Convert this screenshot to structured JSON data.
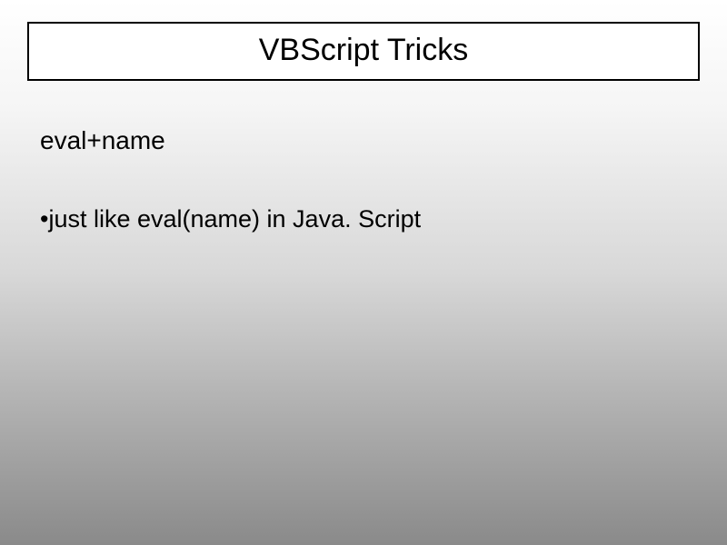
{
  "slide": {
    "title": "VBScript Tricks",
    "subtitle": "eval+name",
    "bullet_marker": "•",
    "bullet_text": "just like eval(name) in Java. Script"
  }
}
